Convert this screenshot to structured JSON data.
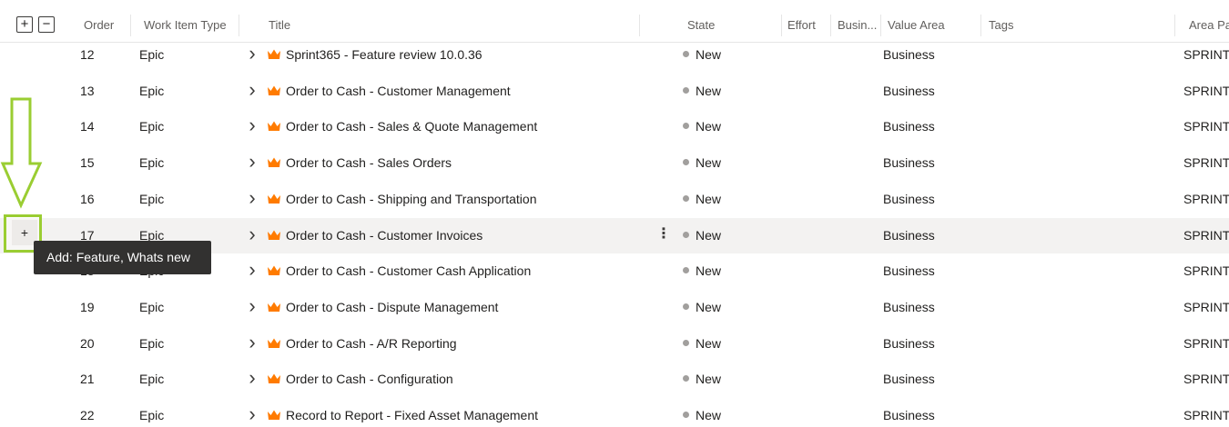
{
  "header": {
    "expand_all_label": "+",
    "collapse_all_label": "−",
    "columns": {
      "order": "Order",
      "work_item_type": "Work Item Type",
      "title": "Title",
      "state": "State",
      "effort": "Effort",
      "business": "Busin...",
      "value_area": "Value Area",
      "tags": "Tags",
      "area_path": "Area Pa"
    }
  },
  "rows": [
    {
      "order": "12",
      "type": "Epic",
      "title": "Sprint365 - Feature review 10.0.36",
      "state": "New",
      "value_area": "Business",
      "area_path": "SPRINT"
    },
    {
      "order": "13",
      "type": "Epic",
      "title": "Order to Cash - Customer Management",
      "state": "New",
      "value_area": "Business",
      "area_path": "SPRINT"
    },
    {
      "order": "14",
      "type": "Epic",
      "title": "Order to Cash - Sales & Quote Management",
      "state": "New",
      "value_area": "Business",
      "area_path": "SPRINT"
    },
    {
      "order": "15",
      "type": "Epic",
      "title": "Order to Cash - Sales Orders",
      "state": "New",
      "value_area": "Business",
      "area_path": "SPRINT"
    },
    {
      "order": "16",
      "type": "Epic",
      "title": "Order to Cash - Shipping and Transportation",
      "state": "New",
      "value_area": "Business",
      "area_path": "SPRINT"
    },
    {
      "order": "17",
      "type": "Epic",
      "title": "Order to Cash - Customer Invoices",
      "state": "New",
      "value_area": "Business",
      "area_path": "SPRINT"
    },
    {
      "order": "18",
      "type": "Epic",
      "title": "Order to Cash - Customer Cash Application",
      "state": "New",
      "value_area": "Business",
      "area_path": "SPRINT"
    },
    {
      "order": "19",
      "type": "Epic",
      "title": "Order to Cash - Dispute Management",
      "state": "New",
      "value_area": "Business",
      "area_path": "SPRINT"
    },
    {
      "order": "20",
      "type": "Epic",
      "title": "Order to Cash - A/R Reporting",
      "state": "New",
      "value_area": "Business",
      "area_path": "SPRINT"
    },
    {
      "order": "21",
      "type": "Epic",
      "title": "Order to Cash - Configuration",
      "state": "New",
      "value_area": "Business",
      "area_path": "SPRINT"
    },
    {
      "order": "22",
      "type": "Epic",
      "title": "Record to Report - Fixed Asset Management",
      "state": "New",
      "value_area": "Business",
      "area_path": "SPRINT"
    }
  ],
  "hovered_row_index": 5,
  "add_button": {
    "label": "+"
  },
  "tooltip": {
    "text": "Add: Feature, Whats new"
  },
  "icons": {
    "row_expand": "chevron-right-icon",
    "work_item": "crown-icon",
    "state": "state-dot-icon",
    "more": "more-vertical-icon"
  },
  "colors": {
    "epic_crown": "#ff7b00",
    "state_new": "#a19f9d",
    "highlight": "#9acd32",
    "tooltip_bg": "#323130",
    "hover_row": "#f3f2f1"
  }
}
